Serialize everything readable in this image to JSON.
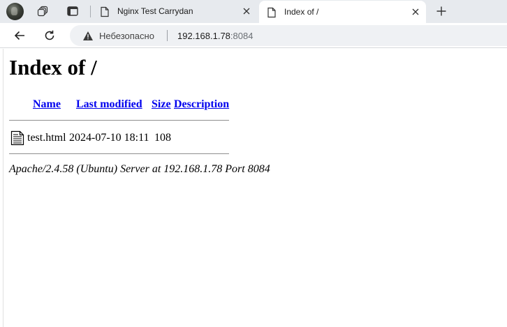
{
  "browser": {
    "tabs": [
      {
        "title": "Nginx Test Carrydan",
        "active": false
      },
      {
        "title": "Index of /",
        "active": true
      }
    ],
    "address_bar": {
      "security_label": "Небезопасно",
      "url_host": "192.168.1.78",
      "url_port": ":8084"
    }
  },
  "listing": {
    "heading": "Index of /",
    "columns": {
      "name": "Name",
      "last_modified": "Last modified",
      "size": "Size",
      "description": "Description"
    },
    "rows": [
      {
        "icon": "file-text-icon",
        "name": "test.html",
        "last_modified": "2024-07-10 18:11",
        "size": "108",
        "description": ""
      }
    ],
    "server_signature": "Apache/2.4.58 (Ubuntu) Server at 192.168.1.78 Port 8084"
  },
  "colors": {
    "tabstrip": "#e7eaee",
    "link": "#0000ee",
    "omnibox": "#eff1f4"
  }
}
